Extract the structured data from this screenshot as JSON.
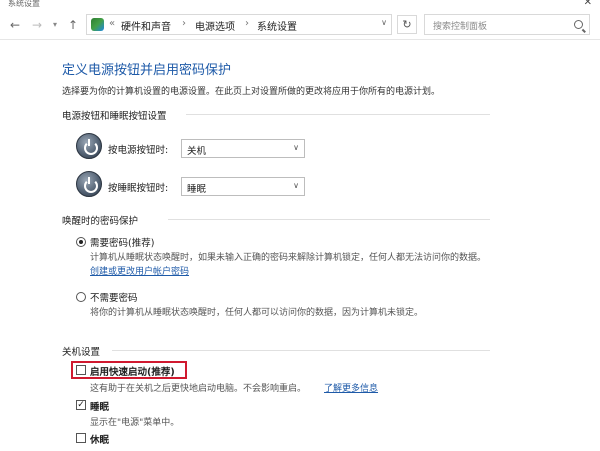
{
  "window": {
    "title": "系统设置",
    "close_glyph": "✕"
  },
  "nav": {
    "back_glyph": "←",
    "forward_glyph": "→",
    "recent_glyph": "▾",
    "up_glyph": "↑"
  },
  "address": {
    "breadcrumb": [
      "硬件和声音",
      "电源选项",
      "系统设置"
    ],
    "prefix": "«",
    "separator": "›",
    "dropdown_glyph": "∨",
    "refresh_glyph": "↻"
  },
  "search": {
    "placeholder": "搜索控制面板"
  },
  "page": {
    "title": "定义电源按钮并启用密码保护",
    "description": "选择要为你的计算机设置的电源设置。在此页上对设置所做的更改将应用于你所有的电源计划。"
  },
  "buttons_section": {
    "header": "电源按钮和睡眠按钮设置",
    "power_button": {
      "label": "按电源按钮时:",
      "value": "关机"
    },
    "sleep_button": {
      "label": "按睡眠按钮时:",
      "value": "睡眠"
    },
    "dropdown_glyph": "∨"
  },
  "password_section": {
    "header": "唤醒时的密码保护",
    "require": {
      "label": "需要密码(推荐)",
      "desc1": "计算机从睡眠状态唤醒时，如果未输入正确的密码来解除计算机锁定，任何人都无法访问你的数据。",
      "link": "创建或更改用户帐户密码",
      "selected": true
    },
    "no_require": {
      "label": "不需要密码",
      "desc": "将你的计算机从睡眠状态唤醒时，任何人都可以访问你的数据，因为计算机未锁定。",
      "selected": false
    }
  },
  "shutdown_section": {
    "header": "关机设置",
    "fast_startup": {
      "label": "启用快速启动(推荐)",
      "desc": "这有助于在关机之后更快地启动电脑。不会影响重启。",
      "link": "了解更多信息",
      "checked": false
    },
    "sleep": {
      "label": "睡眠",
      "desc": "显示在\"电源\"菜单中。",
      "checked": true
    },
    "hibernate": {
      "label": "休眠",
      "checked": false
    },
    "check_glyph": "✓"
  },
  "colors": {
    "accent": "#1e5aa8",
    "highlight": "#d0192f"
  }
}
